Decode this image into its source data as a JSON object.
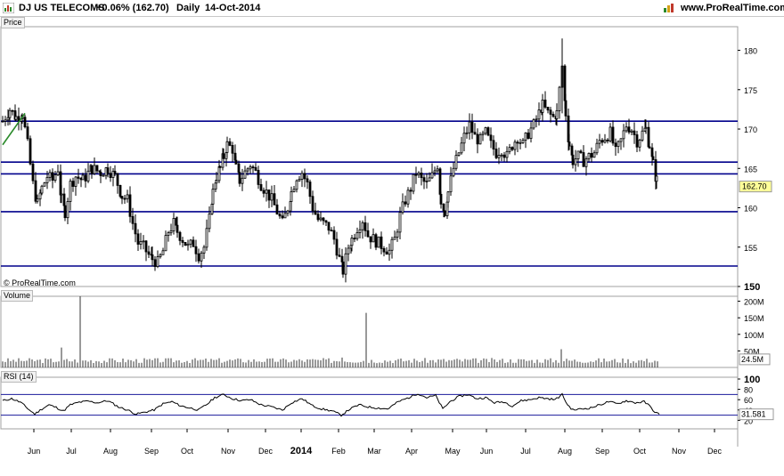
{
  "header": {
    "instrument": "DJ US TELECOMS",
    "change": "+0.06% (162.70)",
    "period": "Daily",
    "date": "14-Oct-2014",
    "website": "www.ProRealTime.com"
  },
  "colors": {
    "hline": "#00008b",
    "trendline": "#2a8a2a",
    "candle": "#000000",
    "rsi_line": "#000000",
    "rsi_level": "#1a1a9c",
    "frame": "#a0a0a0"
  },
  "panels": {
    "price_label": "Price",
    "volume_label": "Volume",
    "rsi_label": "RSI (14)",
    "copyright": "© ProRealTime.com"
  },
  "chart_data": [
    {
      "type": "candlestick",
      "panel": "price",
      "title": "DJ US TELECOMS",
      "x_axis": {
        "labels": [
          "Jun",
          "Jul",
          "Aug",
          "Sep",
          "Oct",
          "Nov",
          "Dec",
          "2014",
          "Feb",
          "Mar",
          "Apr",
          "May",
          "Jun",
          "Jul",
          "Aug",
          "Sep",
          "Oct",
          "Nov",
          "Dec"
        ],
        "label_bold": [
          false,
          false,
          false,
          false,
          false,
          false,
          false,
          true,
          false,
          false,
          false,
          false,
          false,
          false,
          false,
          false,
          false,
          false,
          false
        ]
      },
      "y_axis": {
        "ticks": [
          150,
          155,
          160,
          165,
          170,
          175,
          180
        ],
        "range": [
          150,
          183
        ],
        "last_value": "162.70"
      },
      "horizontal_lines": [
        171.0,
        165.8,
        164.3,
        159.5,
        152.6
      ],
      "trendline": {
        "from": [
          0,
          168.0
        ],
        "to": [
          5,
          172.0
        ]
      },
      "series": [
        {
          "x": 0,
          "y": 171.0
        },
        {
          "x": 8,
          "y": 172.5
        },
        {
          "x": 15,
          "y": 171.5
        },
        {
          "x": 22,
          "y": 172.0
        },
        {
          "x": 28,
          "y": 168.0
        },
        {
          "x": 34,
          "y": 163.0
        },
        {
          "x": 39,
          "y": 160.5
        },
        {
          "x": 44,
          "y": 162.5
        },
        {
          "x": 50,
          "y": 164.0
        },
        {
          "x": 56,
          "y": 163.5
        },
        {
          "x": 62,
          "y": 165.0
        },
        {
          "x": 66,
          "y": 161.0
        },
        {
          "x": 70,
          "y": 159.5
        },
        {
          "x": 76,
          "y": 163.0
        },
        {
          "x": 82,
          "y": 164.0
        },
        {
          "x": 90,
          "y": 163.5
        },
        {
          "x": 100,
          "y": 165.0
        },
        {
          "x": 110,
          "y": 164.5
        },
        {
          "x": 118,
          "y": 165.0
        },
        {
          "x": 126,
          "y": 164.0
        },
        {
          "x": 134,
          "y": 161.5
        },
        {
          "x": 140,
          "y": 161.0
        },
        {
          "x": 146,
          "y": 158.0
        },
        {
          "x": 152,
          "y": 155.5
        },
        {
          "x": 158,
          "y": 155.0
        },
        {
          "x": 164,
          "y": 154.0
        },
        {
          "x": 168,
          "y": 153.5
        },
        {
          "x": 174,
          "y": 153.0
        },
        {
          "x": 180,
          "y": 154.5
        },
        {
          "x": 186,
          "y": 157.0
        },
        {
          "x": 192,
          "y": 158.0
        },
        {
          "x": 196,
          "y": 157.0
        },
        {
          "x": 202,
          "y": 156.0
        },
        {
          "x": 208,
          "y": 155.0
        },
        {
          "x": 214,
          "y": 155.5
        },
        {
          "x": 220,
          "y": 154.0
        },
        {
          "x": 226,
          "y": 155.0
        },
        {
          "x": 232,
          "y": 158.5
        },
        {
          "x": 236,
          "y": 162.0
        },
        {
          "x": 240,
          "y": 164.0
        },
        {
          "x": 244,
          "y": 165.0
        },
        {
          "x": 248,
          "y": 166.5
        },
        {
          "x": 252,
          "y": 168.0
        },
        {
          "x": 258,
          "y": 167.5
        },
        {
          "x": 262,
          "y": 165.0
        },
        {
          "x": 266,
          "y": 163.5
        },
        {
          "x": 272,
          "y": 164.5
        },
        {
          "x": 278,
          "y": 165.5
        },
        {
          "x": 284,
          "y": 164.5
        },
        {
          "x": 290,
          "y": 163.0
        },
        {
          "x": 296,
          "y": 162.0
        },
        {
          "x": 302,
          "y": 161.0
        },
        {
          "x": 308,
          "y": 159.5
        },
        {
          "x": 314,
          "y": 158.0
        },
        {
          "x": 320,
          "y": 160.0
        },
        {
          "x": 324,
          "y": 162.0
        },
        {
          "x": 330,
          "y": 164.0
        },
        {
          "x": 336,
          "y": 164.5
        },
        {
          "x": 342,
          "y": 163.0
        },
        {
          "x": 348,
          "y": 160.0
        },
        {
          "x": 354,
          "y": 158.5
        },
        {
          "x": 360,
          "y": 158.0
        },
        {
          "x": 366,
          "y": 157.5
        },
        {
          "x": 372,
          "y": 156.0
        },
        {
          "x": 378,
          "y": 153.5
        },
        {
          "x": 382,
          "y": 152.0
        },
        {
          "x": 388,
          "y": 155.0
        },
        {
          "x": 392,
          "y": 156.0
        },
        {
          "x": 398,
          "y": 157.5
        },
        {
          "x": 404,
          "y": 158.5
        },
        {
          "x": 410,
          "y": 156.5
        },
        {
          "x": 416,
          "y": 156.0
        },
        {
          "x": 422,
          "y": 155.5
        },
        {
          "x": 428,
          "y": 155.0
        },
        {
          "x": 434,
          "y": 154.5
        },
        {
          "x": 440,
          "y": 156.0
        },
        {
          "x": 446,
          "y": 159.0
        },
        {
          "x": 452,
          "y": 161.0
        },
        {
          "x": 458,
          "y": 162.5
        },
        {
          "x": 464,
          "y": 164.5
        },
        {
          "x": 470,
          "y": 163.5
        },
        {
          "x": 476,
          "y": 163.0
        },
        {
          "x": 482,
          "y": 164.0
        },
        {
          "x": 488,
          "y": 165.5
        },
        {
          "x": 492,
          "y": 161.0
        },
        {
          "x": 496,
          "y": 159.5
        },
        {
          "x": 500,
          "y": 162.0
        },
        {
          "x": 506,
          "y": 165.0
        },
        {
          "x": 512,
          "y": 167.0
        },
        {
          "x": 518,
          "y": 169.0
        },
        {
          "x": 524,
          "y": 170.5
        },
        {
          "x": 530,
          "y": 169.0
        },
        {
          "x": 536,
          "y": 168.5
        },
        {
          "x": 542,
          "y": 169.5
        },
        {
          "x": 548,
          "y": 168.0
        },
        {
          "x": 554,
          "y": 167.0
        },
        {
          "x": 560,
          "y": 167.5
        },
        {
          "x": 566,
          "y": 166.5
        },
        {
          "x": 572,
          "y": 168.0
        },
        {
          "x": 578,
          "y": 169.0
        },
        {
          "x": 584,
          "y": 168.0
        },
        {
          "x": 590,
          "y": 169.5
        },
        {
          "x": 596,
          "y": 170.5
        },
        {
          "x": 602,
          "y": 172.0
        },
        {
          "x": 606,
          "y": 173.0
        },
        {
          "x": 612,
          "y": 172.0
        },
        {
          "x": 618,
          "y": 171.5
        },
        {
          "x": 622,
          "y": 172.0
        },
        {
          "x": 625,
          "y": 175.0
        },
        {
          "x": 628,
          "y": 178.0
        },
        {
          "x": 632,
          "y": 172.0
        },
        {
          "x": 636,
          "y": 168.0
        },
        {
          "x": 640,
          "y": 166.0
        },
        {
          "x": 646,
          "y": 166.5
        },
        {
          "x": 652,
          "y": 166.0
        },
        {
          "x": 658,
          "y": 166.5
        },
        {
          "x": 664,
          "y": 167.0
        },
        {
          "x": 670,
          "y": 168.5
        },
        {
          "x": 676,
          "y": 169.0
        },
        {
          "x": 682,
          "y": 169.5
        },
        {
          "x": 688,
          "y": 167.0
        },
        {
          "x": 694,
          "y": 168.5
        },
        {
          "x": 700,
          "y": 170.5
        },
        {
          "x": 706,
          "y": 170.0
        },
        {
          "x": 712,
          "y": 168.5
        },
        {
          "x": 718,
          "y": 169.5
        },
        {
          "x": 722,
          "y": 170.0
        },
        {
          "x": 726,
          "y": 168.0
        },
        {
          "x": 730,
          "y": 165.5
        },
        {
          "x": 734,
          "y": 163.5
        },
        {
          "x": 737,
          "y": 162.7
        }
      ]
    },
    {
      "type": "bar",
      "panel": "volume",
      "title": "Volume",
      "y_axis": {
        "ticks": [
          "200M",
          "150M",
          "100M",
          "50M"
        ],
        "tick_values": [
          200,
          150,
          100,
          50
        ],
        "range": [
          0,
          215
        ],
        "last_value": "24.5M"
      },
      "spikes": [
        {
          "x": 88,
          "y": 215
        },
        {
          "x": 67,
          "y": 60
        },
        {
          "x": 409,
          "y": 165
        },
        {
          "x": 627,
          "y": 55
        },
        {
          "x": 382,
          "y": 30
        },
        {
          "x": 542,
          "y": 26
        },
        {
          "x": 212,
          "y": 24
        }
      ],
      "base_level": 22
    },
    {
      "type": "line",
      "panel": "rsi",
      "title": "RSI (14)",
      "y_axis": {
        "ticks": [
          100,
          80,
          60,
          40,
          20
        ],
        "range": [
          0,
          100
        ],
        "last_value": "31.581"
      },
      "levels": [
        70,
        30
      ],
      "series": [
        {
          "x": 0,
          "y": 58
        },
        {
          "x": 10,
          "y": 62
        },
        {
          "x": 20,
          "y": 55
        },
        {
          "x": 30,
          "y": 40
        },
        {
          "x": 36,
          "y": 32
        },
        {
          "x": 44,
          "y": 42
        },
        {
          "x": 52,
          "y": 50
        },
        {
          "x": 60,
          "y": 45
        },
        {
          "x": 68,
          "y": 38
        },
        {
          "x": 76,
          "y": 50
        },
        {
          "x": 86,
          "y": 55
        },
        {
          "x": 96,
          "y": 57
        },
        {
          "x": 106,
          "y": 54
        },
        {
          "x": 118,
          "y": 58
        },
        {
          "x": 130,
          "y": 46
        },
        {
          "x": 140,
          "y": 40
        },
        {
          "x": 150,
          "y": 32
        },
        {
          "x": 160,
          "y": 36
        },
        {
          "x": 170,
          "y": 40
        },
        {
          "x": 180,
          "y": 52
        },
        {
          "x": 190,
          "y": 56
        },
        {
          "x": 200,
          "y": 48
        },
        {
          "x": 210,
          "y": 44
        },
        {
          "x": 220,
          "y": 40
        },
        {
          "x": 230,
          "y": 52
        },
        {
          "x": 238,
          "y": 64
        },
        {
          "x": 248,
          "y": 70
        },
        {
          "x": 258,
          "y": 62
        },
        {
          "x": 268,
          "y": 58
        },
        {
          "x": 278,
          "y": 60
        },
        {
          "x": 290,
          "y": 50
        },
        {
          "x": 302,
          "y": 46
        },
        {
          "x": 314,
          "y": 40
        },
        {
          "x": 324,
          "y": 54
        },
        {
          "x": 336,
          "y": 62
        },
        {
          "x": 348,
          "y": 48
        },
        {
          "x": 358,
          "y": 42
        },
        {
          "x": 370,
          "y": 38
        },
        {
          "x": 380,
          "y": 30
        },
        {
          "x": 390,
          "y": 42
        },
        {
          "x": 400,
          "y": 50
        },
        {
          "x": 410,
          "y": 46
        },
        {
          "x": 420,
          "y": 44
        },
        {
          "x": 432,
          "y": 42
        },
        {
          "x": 444,
          "y": 56
        },
        {
          "x": 456,
          "y": 64
        },
        {
          "x": 466,
          "y": 72
        },
        {
          "x": 476,
          "y": 64
        },
        {
          "x": 486,
          "y": 68
        },
        {
          "x": 494,
          "y": 42
        },
        {
          "x": 502,
          "y": 56
        },
        {
          "x": 512,
          "y": 66
        },
        {
          "x": 522,
          "y": 70
        },
        {
          "x": 532,
          "y": 62
        },
        {
          "x": 542,
          "y": 64
        },
        {
          "x": 552,
          "y": 54
        },
        {
          "x": 562,
          "y": 56
        },
        {
          "x": 572,
          "y": 48
        },
        {
          "x": 582,
          "y": 58
        },
        {
          "x": 592,
          "y": 60
        },
        {
          "x": 602,
          "y": 64
        },
        {
          "x": 612,
          "y": 62
        },
        {
          "x": 620,
          "y": 60
        },
        {
          "x": 628,
          "y": 70
        },
        {
          "x": 634,
          "y": 50
        },
        {
          "x": 640,
          "y": 40
        },
        {
          "x": 650,
          "y": 42
        },
        {
          "x": 660,
          "y": 44
        },
        {
          "x": 670,
          "y": 50
        },
        {
          "x": 680,
          "y": 56
        },
        {
          "x": 690,
          "y": 52
        },
        {
          "x": 700,
          "y": 58
        },
        {
          "x": 710,
          "y": 54
        },
        {
          "x": 720,
          "y": 56
        },
        {
          "x": 726,
          "y": 48
        },
        {
          "x": 732,
          "y": 36
        },
        {
          "x": 737,
          "y": 31.6
        }
      ]
    }
  ]
}
